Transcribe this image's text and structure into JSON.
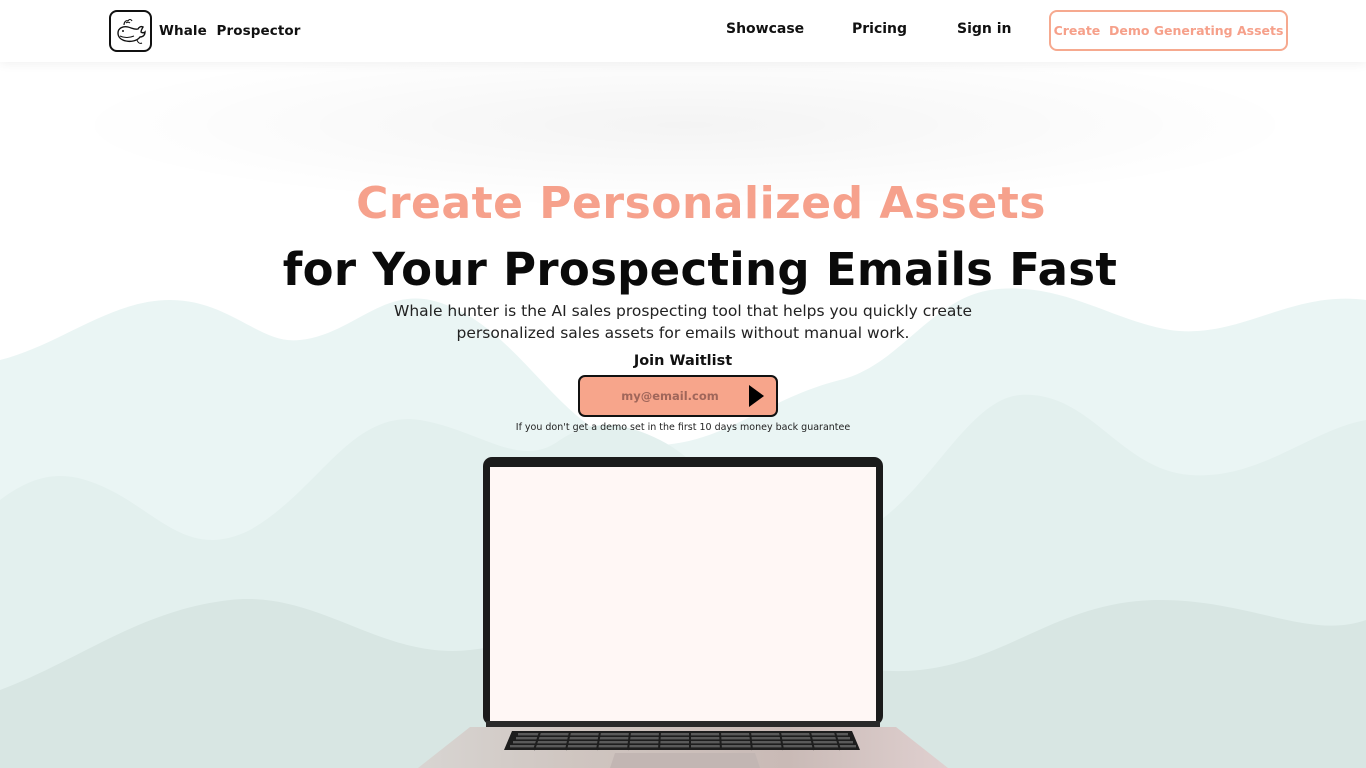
{
  "nav": {
    "brand": "Whale  Prospector",
    "links": [
      {
        "label": "Showcase"
      },
      {
        "label": "Pricing"
      },
      {
        "label": "Sign in"
      }
    ],
    "cta": "Create  Demo Generating Assets",
    "logo_icon": "whale-icon"
  },
  "hero": {
    "headline_accent": "Create Personalized Assets",
    "headline_main": "for Your Prospecting Emails Fast",
    "subtitle_line1": "Whale hunter is the AI sales prospecting tool that helps you quickly create",
    "subtitle_line2": "personalized sales assets for emails without manual work.",
    "waitlist_label": "Join Waitlist",
    "email_placeholder": "my@email.com",
    "submit_icon": "play-triangle-icon",
    "guarantee": "If you don't get a demo set in the first 10 days money back guarantee"
  },
  "colors": {
    "accent": "#f6a18c",
    "form_bg": "#f7a58b",
    "wave_light": "#e9f4f3",
    "wave_mid": "#dde9e7",
    "screen": "#fff7f5"
  }
}
